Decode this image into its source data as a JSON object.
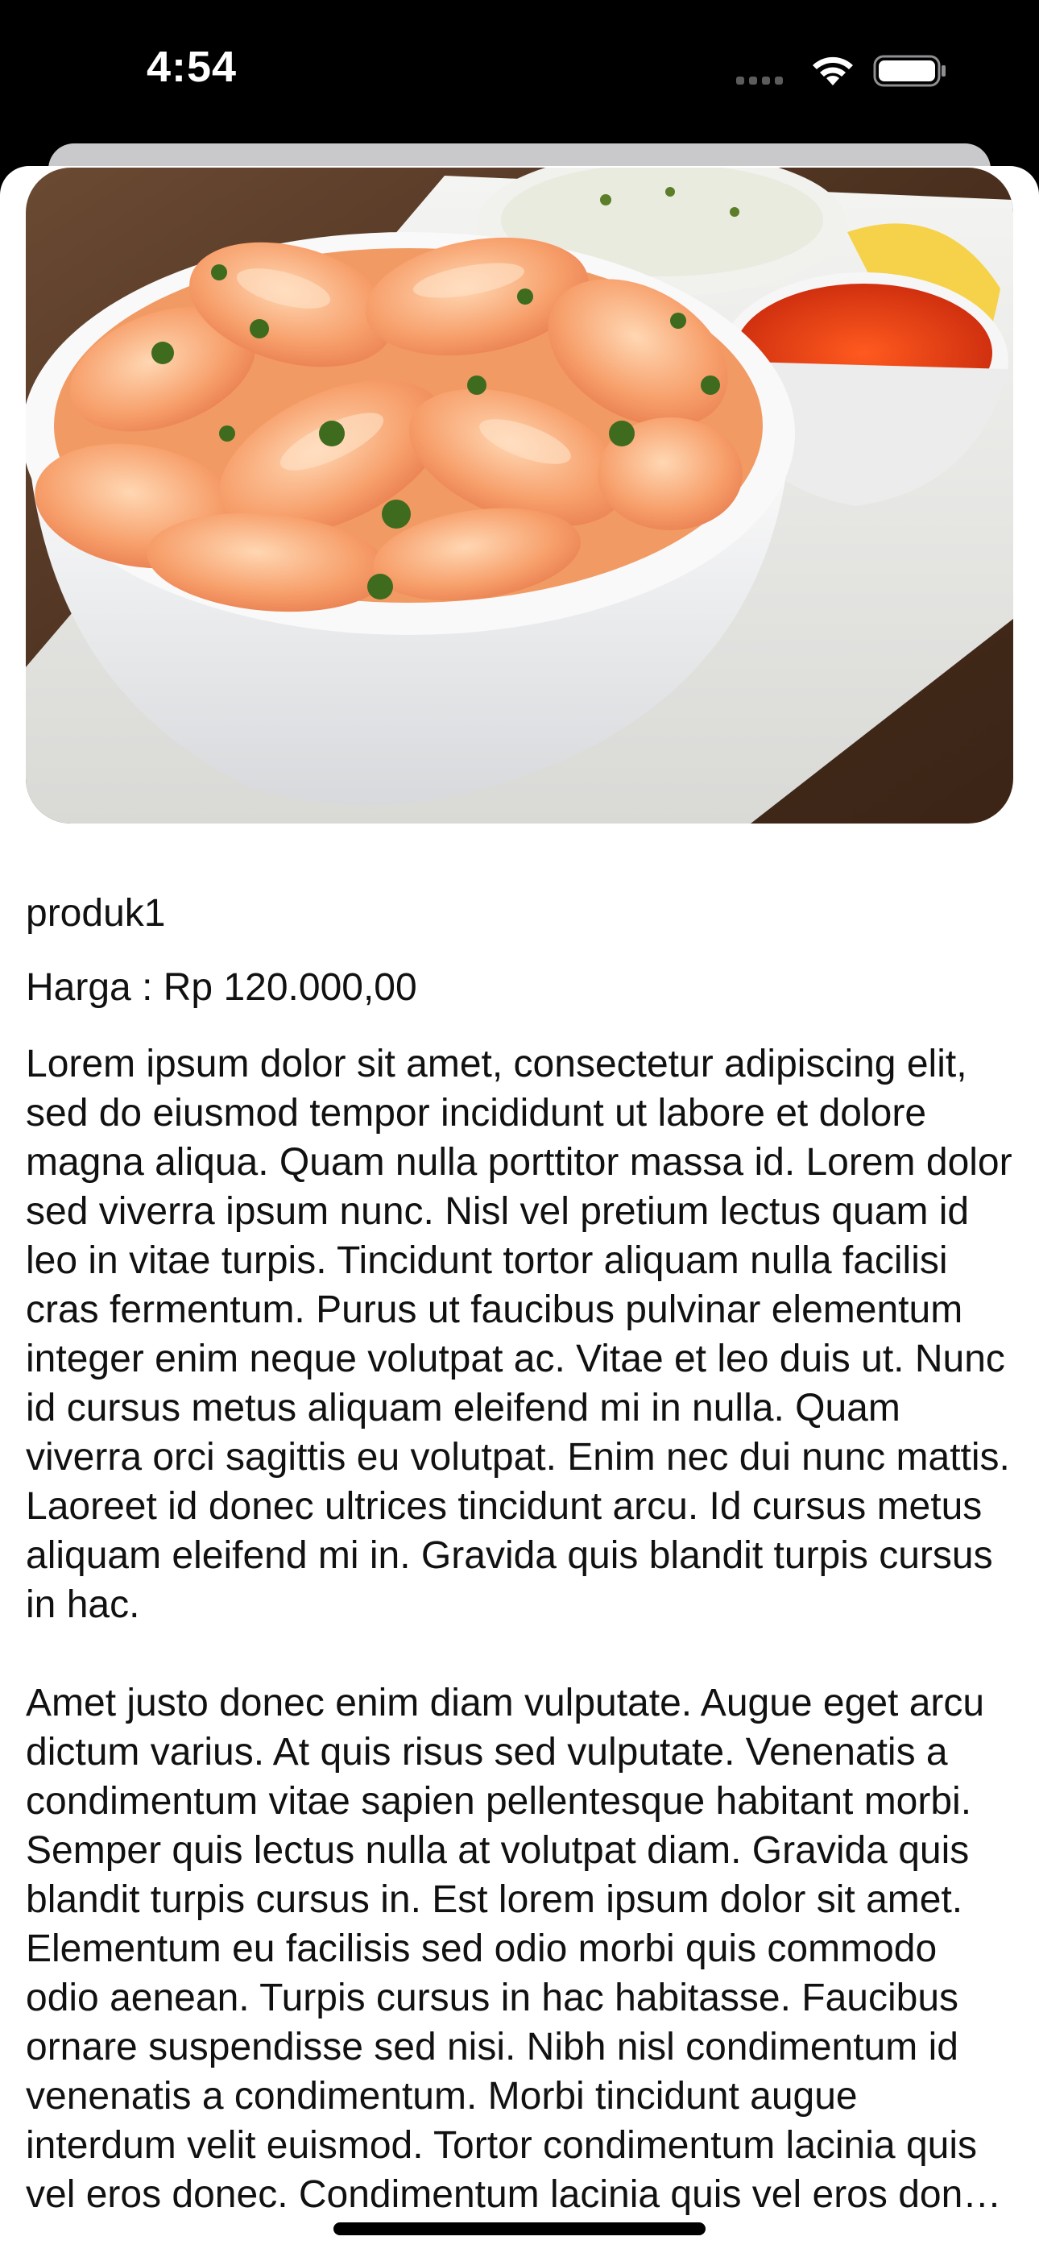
{
  "status_bar": {
    "time": "4:54"
  },
  "product": {
    "image_description": "shrimp-cocktail-photo",
    "name": "produk1",
    "price_label": "Harga : ",
    "price_value": "Rp 120.000,00",
    "description_p1": "Lorem ipsum dolor sit amet, consectetur adipiscing elit, sed do eiusmod tempor incididunt ut labore et dolore magna aliqua. Quam nulla porttitor massa id. Lorem dolor sed viverra ipsum nunc. Nisl vel pretium lectus quam id leo in vitae turpis. Tincidunt tortor aliquam nulla facilisi cras fermentum. Purus ut faucibus pulvinar elementum integer enim neque volutpat ac. Vitae et leo duis ut. Nunc id cursus metus aliquam eleifend mi in nulla. Quam viverra orci sagittis eu volutpat. Enim nec dui nunc mattis. Laoreet id donec ultrices tincidunt arcu. Id cursus metus aliquam eleifend mi in. Gravida quis blandit turpis cursus in hac.",
    "description_p2": "Amet justo donec enim diam vulputate. Augue eget arcu dictum varius. At quis risus sed vulputate. Venenatis a condimentum vitae sapien pellentesque habitant morbi. Semper quis lectus nulla at volutpat diam. Gravida quis blandit turpis cursus in. Est lorem ipsum dolor sit amet. Elementum eu facilisis sed odio morbi quis commodo odio aenean. Turpis cursus in hac habitasse. Faucibus ornare suspendisse sed nisi. Nibh nisl condimentum id venenatis a condimentum. Morbi tincidunt augue interdum velit euismod. Tortor condimentum lacinia quis vel eros donec. Condimentum lacinia quis vel eros donec ac odio tempor."
  },
  "colors": {
    "status_bar_bg": "#000000",
    "sheet_bg": "#ffffff",
    "text": "#111111"
  }
}
